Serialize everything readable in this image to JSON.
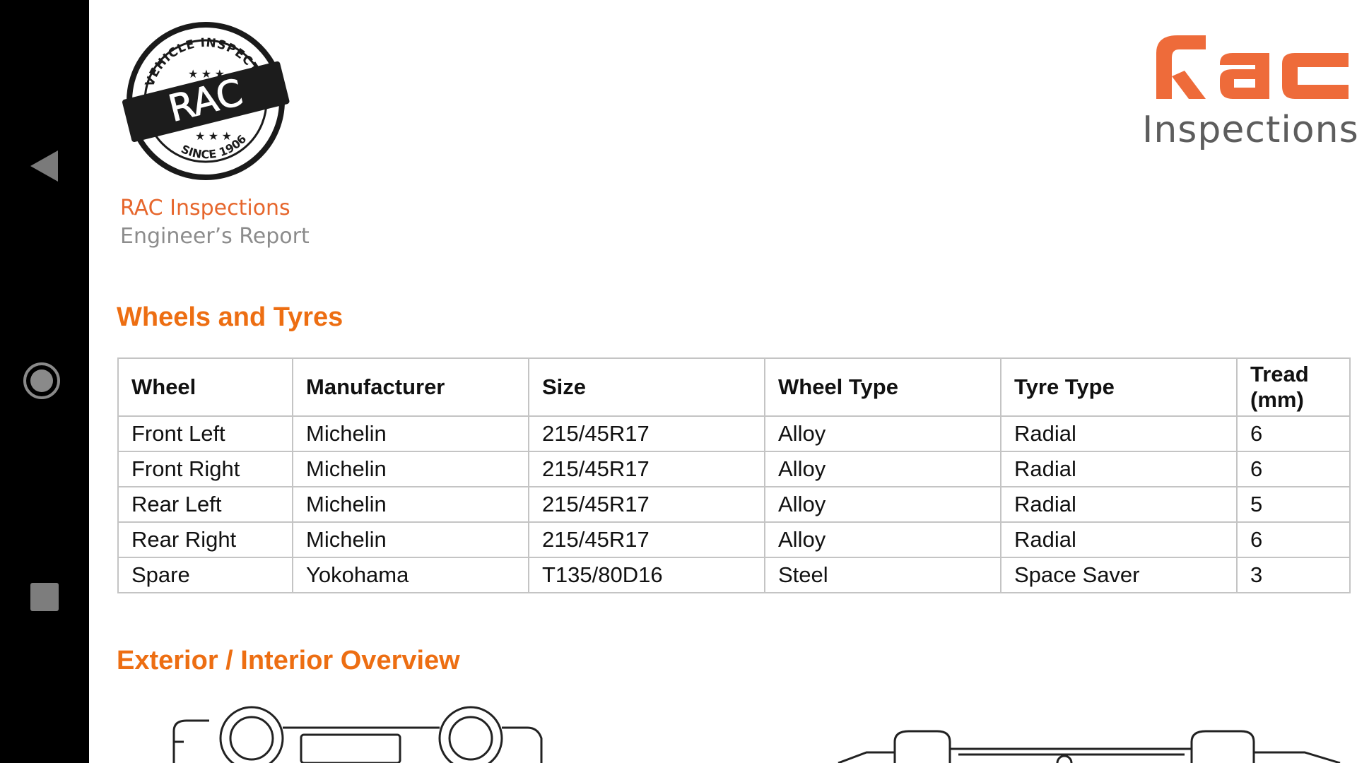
{
  "nav": {
    "back_icon": "back-triangle-icon",
    "home_icon": "home-circle-icon",
    "recents_icon": "recents-square-icon"
  },
  "header": {
    "seal": {
      "ring_text": "VEHICLE INSPECTION",
      "center_text": "RAC",
      "since_text": "SINCE 1906"
    },
    "brand": "RAC Inspections",
    "subtitle": "Engineer’s Report",
    "logo": {
      "mark": "RAC",
      "word": "Inspections",
      "color": "#ee6b3a"
    }
  },
  "wheels_section": {
    "title": "Wheels and Tyres",
    "columns": [
      "Wheel",
      "Manufacturer",
      "Size",
      "Wheel Type",
      "Tyre Type",
      "Tread (mm)"
    ],
    "rows": [
      [
        "Front Left",
        "Michelin",
        "215/45R17",
        "Alloy",
        "Radial",
        "6"
      ],
      [
        "Front Right",
        "Michelin",
        "215/45R17",
        "Alloy",
        "Radial",
        "6"
      ],
      [
        "Rear Left",
        "Michelin",
        "215/45R17",
        "Alloy",
        "Radial",
        "5"
      ],
      [
        "Rear Right",
        "Michelin",
        "215/45R17",
        "Alloy",
        "Radial",
        "6"
      ],
      [
        "Spare",
        "Yokohama",
        "T135/80D16",
        "Steel",
        "Space Saver",
        "3"
      ]
    ]
  },
  "overview_section": {
    "title": "Exterior / Interior Overview"
  },
  "colors": {
    "accent": "#ed6e12",
    "brand": "#e6662c",
    "grey_text": "#8c8c8c"
  }
}
